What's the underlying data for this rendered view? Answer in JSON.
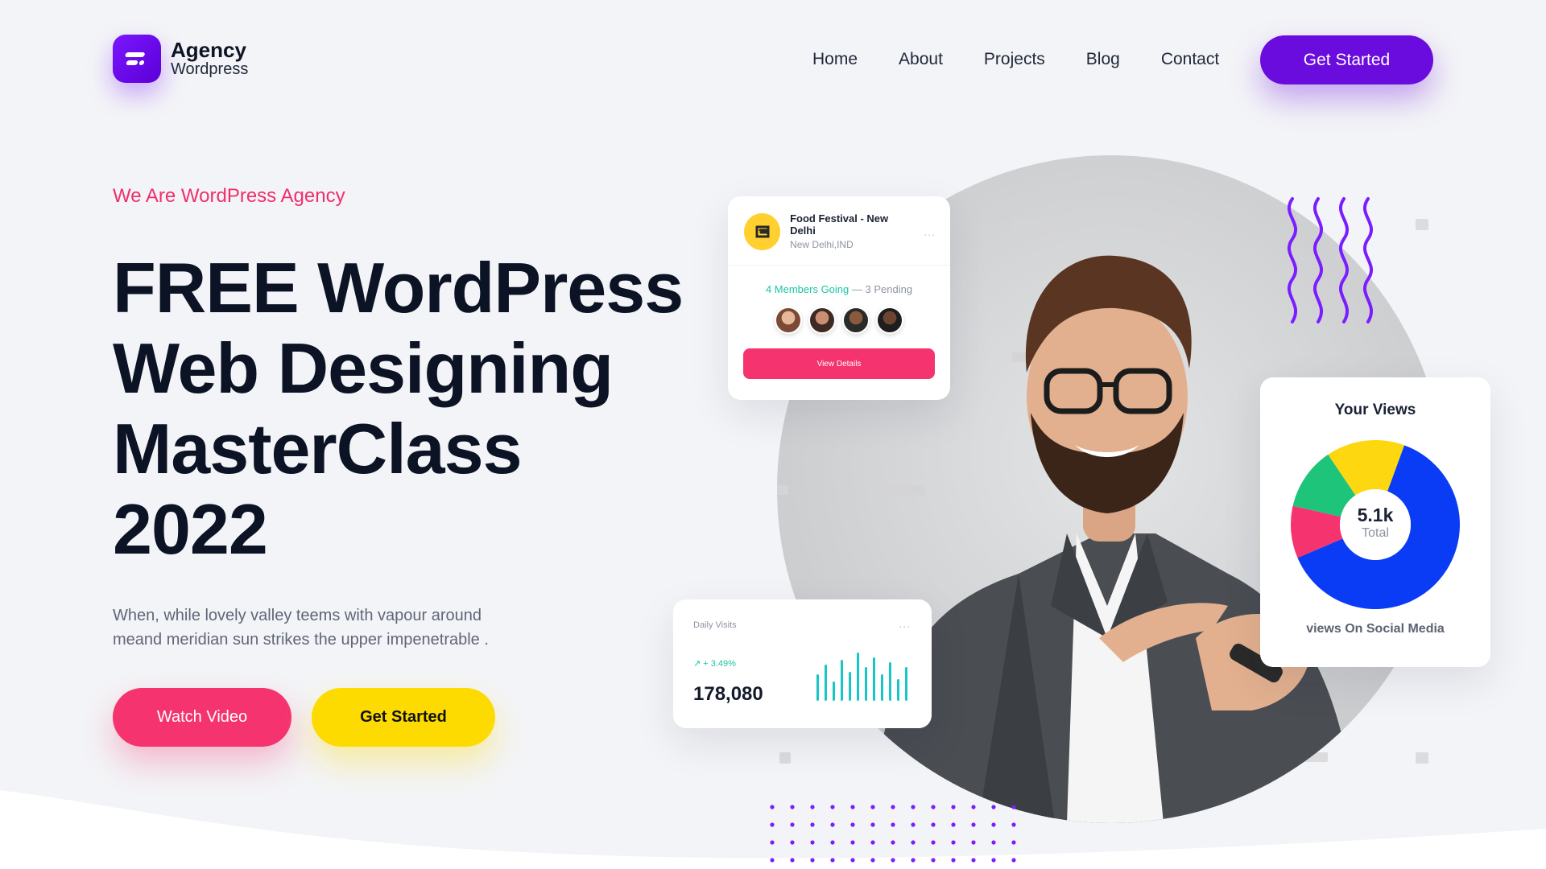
{
  "brand": {
    "name": "Agency",
    "sub": "Wordpress",
    "logo_icon": "agency-logo-icon",
    "accent": "#6a0cde"
  },
  "nav": {
    "items": [
      "Home",
      "About",
      "Projects",
      "Blog",
      "Contact"
    ],
    "cta": "Get Started"
  },
  "hero": {
    "eyebrow": "We Are WordPress Agency",
    "title_lines": [
      "FREE WordPress",
      "Web Designing",
      "MasterClass",
      "2022"
    ],
    "description_lines": [
      "When, while lovely valley teems with vapour around",
      "meand meridian sun strikes the upper impenetrable ."
    ],
    "watch_label": "Watch Video",
    "start_label": "Get Started",
    "colors": {
      "pink": "#f5336e",
      "yellow": "#fedb00",
      "eyebrow": "#ef2f6d"
    }
  },
  "event_card": {
    "title": "Food Festival - New Delhi",
    "location": "New Delhi,IND",
    "more": "...",
    "members_going": "4 Members Going",
    "separator": " — ",
    "pending": "3 Pending",
    "button": "View Details",
    "avatar_count": 4
  },
  "visits_card": {
    "title": "Daily Visits",
    "more": "...",
    "change": "+ 3.49%",
    "value": "178,080",
    "bars": [
      0.55,
      0.75,
      0.4,
      0.85,
      0.6,
      1.0,
      0.7,
      0.9,
      0.55,
      0.8,
      0.45,
      0.7
    ],
    "bar_color": "#19c6c6"
  },
  "views_card": {
    "title": "Your Views",
    "total": "5.1k",
    "total_label": "Total",
    "footer": "views On Social Media",
    "segments": [
      {
        "color": "#0a3cf5",
        "value": 63
      },
      {
        "color": "#f5336e",
        "value": 10
      },
      {
        "color": "#1ec47a",
        "value": 12
      },
      {
        "color": "#fdd70f",
        "value": 15
      }
    ]
  }
}
